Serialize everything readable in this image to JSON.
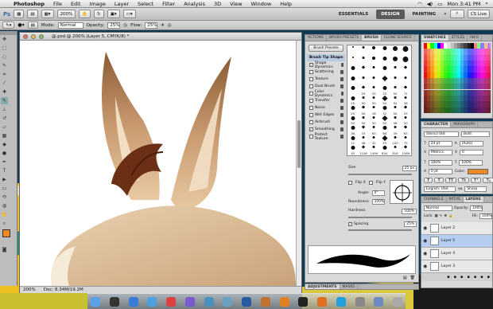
{
  "menubar": {
    "app": "Photoshop",
    "items": [
      "File",
      "Edit",
      "Image",
      "Layer",
      "Select",
      "Filter",
      "Analysis",
      "3D",
      "View",
      "Window",
      "Help"
    ],
    "clock": "Mon 3:41 PM"
  },
  "appbar": {
    "zoom": "200%",
    "workspaces": [
      "ESSENTIALS",
      "DESIGN",
      "PAINTING"
    ],
    "cs_live": "CS Live"
  },
  "options": {
    "mode_label": "Mode:",
    "mode_value": "Normal",
    "opacity_label": "Opacity:",
    "opacity_value": "25%",
    "flow_label": "Flow:",
    "flow_value": "25%"
  },
  "document": {
    "title": "@.psd @ 200% (Layer 5, CMYK/8) *",
    "zoom": "200%",
    "doc_size": "Doc: 8.34M/19.2M"
  },
  "brush_panel": {
    "tabs": [
      "ACTIONS",
      "BRUSH PRESETS",
      "BRUSH",
      "CLONE SOURCE"
    ],
    "presets_button": "Brush Presets",
    "options": [
      {
        "label": "Brush Tip Shape",
        "checked": false,
        "header": true
      },
      {
        "label": "Shape Dynamics",
        "checked": true
      },
      {
        "label": "Scattering",
        "checked": false
      },
      {
        "label": "Texture",
        "checked": false
      },
      {
        "label": "Dual Brush",
        "checked": false
      },
      {
        "label": "Color Dynamics",
        "checked": false
      },
      {
        "label": "Transfer",
        "checked": false
      },
      {
        "label": "Noise",
        "checked": false
      },
      {
        "label": "Wet Edges",
        "checked": false
      },
      {
        "label": "Airbrush",
        "checked": false
      },
      {
        "label": "Smoothing",
        "checked": true
      },
      {
        "label": "Protect Texture",
        "checked": false
      }
    ],
    "tip_sizes": [
      "",
      "",
      "",
      "",
      "",
      "",
      "",
      "",
      "",
      "",
      "",
      "",
      "",
      "",
      "",
      "",
      "",
      "",
      "",
      "",
      "",
      "",
      "",
      "",
      "",
      "",
      "",
      "",
      "",
      "",
      "",
      "",
      "",
      "",
      "",
      "",
      "",
      "",
      "",
      "",
      "",
      "",
      "",
      "",
      "",
      "",
      "",
      "",
      "",
      "",
      "",
      "",
      "",
      "",
      "",
      "",
      "",
      "",
      "",
      "",
      "",
      "",
      "",
      "",
      "",
      "",
      "",
      "",
      "",
      "",
      "",
      "",
      "",
      "",
      "",
      "25",
      "25",
      "25",
      "50",
      "71",
      "25",
      "50",
      "50",
      "50",
      "50",
      "36",
      "25",
      "50",
      "16",
      "32",
      "50",
      "25",
      "50",
      "50",
      "50",
      "50",
      "56",
      "50",
      "36",
      "33",
      "63",
      "66",
      "39",
      "63",
      "11",
      "48",
      "32",
      "55",
      "100",
      "75",
      "45",
      "1106",
      "1499",
      "844",
      "818",
      "1569"
    ],
    "size_label": "Size",
    "size_value": "25 px",
    "flip_x": "Flip X",
    "flip_y": "Flip Y",
    "angle_label": "Angle:",
    "angle_value": "0°",
    "roundness_label": "Roundness:",
    "roundness_value": "100%",
    "hardness_label": "Hardness",
    "hardness_value": "100%",
    "spacing_label": "Spacing",
    "spacing_value": "25%",
    "bottom_tabs": [
      "ADJUSTMENTS",
      "MASKS"
    ]
  },
  "swatches_panel": {
    "tabs": [
      "SWATCHES",
      "STYLES",
      "INFO"
    ]
  },
  "character_panel": {
    "tabs": [
      "CHARACTER",
      "PARAGRAPH"
    ],
    "font": "Stencil Std",
    "style": "Bold",
    "size": "24 pt",
    "leading": "(Auto)",
    "tracking": "Metrics",
    "kerning": "0",
    "vscale": "100%",
    "hscale": "100%",
    "baseline": "0 pt",
    "color_label": "Color:",
    "color": "#ee8a25",
    "language": "English: USA",
    "aa": "Sharp"
  },
  "layers_panel": {
    "tabs": [
      "CHANNELS",
      "PATHS",
      "LAYERS"
    ],
    "blend": "Normal",
    "opacity_label": "Opacity:",
    "opacity": "100%",
    "lock_label": "Lock:",
    "fill_label": "Fill:",
    "fill": "100%",
    "layers": [
      {
        "name": "Layer 2",
        "selected": false
      },
      {
        "name": "Layer 5",
        "selected": true
      },
      {
        "name": "Layer 4",
        "selected": false
      },
      {
        "name": "Layer 3",
        "selected": false
      }
    ]
  },
  "colors": {
    "accent_orange": "#ee8a25",
    "selection_blue": "#b4cdf0"
  }
}
